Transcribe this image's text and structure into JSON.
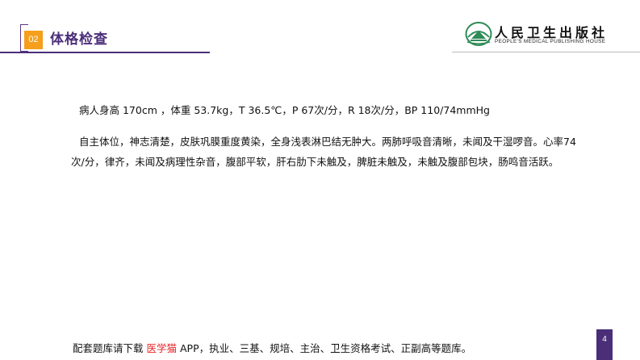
{
  "header": {
    "number": "02",
    "title": "体格检查"
  },
  "logo": {
    "cn": "人民卫生出版社",
    "en": "PEOPLE'S MEDICAL PUBLISHING HOUSE",
    "icon": "publisher-emblem-icon",
    "accent": "#2e8b57"
  },
  "content": {
    "vitals": "病人身高 170cm ，体重 53.7kg，T 36.5℃，P 67次/分，R 18次/分，BP 110/74mmHg",
    "exam": "自主体位，神志清楚，皮肤巩膜重度黄染，全身浅表淋巴结无肿大。两肺呼吸音清晰，未闻及干湿啰音。心率74次/分，律齐，未闻及病理性杂音，腹部平软，肝右肋下未触及，脾脏未触及，未触及腹部包块，肠鸣音活跃。"
  },
  "footer": {
    "prefix": "配套题库请下载",
    "app_name": "医学猫",
    "suffix": "APP，执业、三基、规培、主治、卫生资格考试、正副高等题库。"
  },
  "page_number": "4",
  "colors": {
    "brand_purple": "#4a2f78",
    "accent_orange": "#f59f1c",
    "app_red": "#e8262a"
  }
}
